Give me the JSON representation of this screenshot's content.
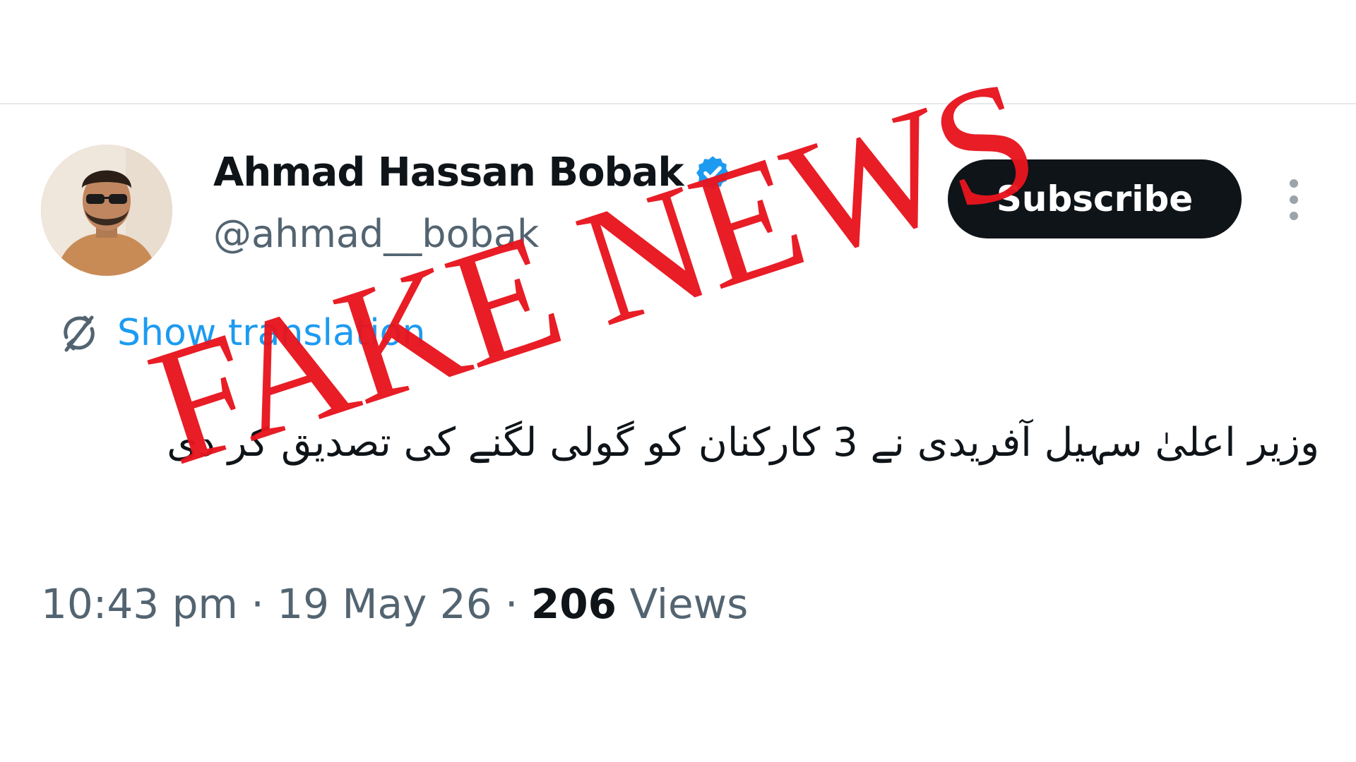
{
  "author": {
    "display_name": "Ahmad Hassan Bobak",
    "handle": "@ahmad__bobak",
    "verified": true,
    "avatar_icon": "profile-photo"
  },
  "actions": {
    "subscribe_label": "Subscribe",
    "more_icon": "more-vertical-icon"
  },
  "translation": {
    "label": "Show translation",
    "icon": "translate-icon"
  },
  "tweet": {
    "text": "وزیر اعلیٰ سہیل آفریدی نے 3 کارکنان کو گولی لگنے کی تصدیق کر دی"
  },
  "meta": {
    "time": "10:43 pm",
    "separator": "·",
    "date": "19 May 26",
    "views_count": "206",
    "views_label": "Views"
  },
  "overlay": {
    "stamp_text": "FAKE NEWS"
  },
  "colors": {
    "text_primary": "#0f1419",
    "text_secondary": "#536471",
    "link_blue": "#1d9bf0",
    "stamp_red": "#e8141e"
  }
}
